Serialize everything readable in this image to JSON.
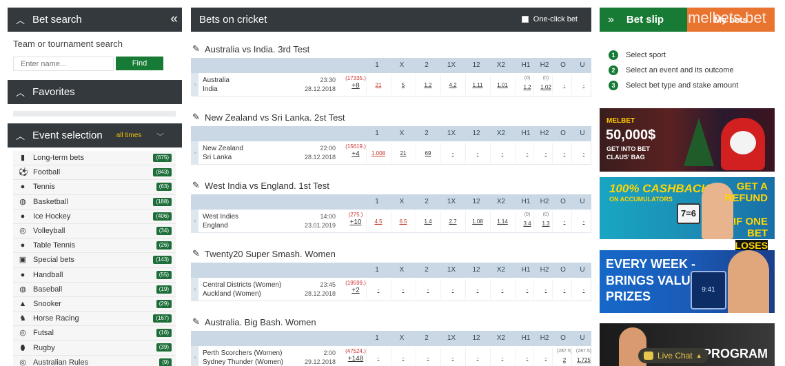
{
  "bet_search": {
    "title": "Bet search",
    "label": "Team or tournament search",
    "placeholder": "Enter name...",
    "find_label": "Find"
  },
  "favorites": {
    "title": "Favorites"
  },
  "event_selection": {
    "title": "Event selection",
    "filter": "all times",
    "sports": [
      {
        "name": "Long-term bets",
        "count": "(675)",
        "icon": "chart-bars-icon"
      },
      {
        "name": "Football",
        "count": "(843)",
        "icon": "football-icon"
      },
      {
        "name": "Tennis",
        "count": "(63)",
        "icon": "tennis-icon"
      },
      {
        "name": "Basketball",
        "count": "(188)",
        "icon": "basketball-icon"
      },
      {
        "name": "Ice Hockey",
        "count": "(406)",
        "icon": "ice-hockey-icon"
      },
      {
        "name": "Volleyball",
        "count": "(34)",
        "icon": "volleyball-icon"
      },
      {
        "name": "Table Tennis",
        "count": "(26)",
        "icon": "table-tennis-icon"
      },
      {
        "name": "Special bets",
        "count": "(143)",
        "icon": "special-bets-icon"
      },
      {
        "name": "Handball",
        "count": "(55)",
        "icon": "handball-icon"
      },
      {
        "name": "Baseball",
        "count": "(19)",
        "icon": "baseball-icon"
      },
      {
        "name": "Snooker",
        "count": "(29)",
        "icon": "snooker-icon"
      },
      {
        "name": "Horse Racing",
        "count": "(167)",
        "icon": "horse-racing-icon"
      },
      {
        "name": "Futsal",
        "count": "(16)",
        "icon": "futsal-icon"
      },
      {
        "name": "Rugby",
        "count": "(39)",
        "icon": "rugby-icon"
      },
      {
        "name": "Australian Rules",
        "count": "(9)",
        "icon": "australian-rules-icon"
      }
    ]
  },
  "main": {
    "title": "Bets on cricket",
    "one_click": "One-click bet",
    "columns": [
      "1",
      "X",
      "2",
      "1X",
      "12",
      "X2",
      "H1",
      "H2",
      "O",
      "U"
    ],
    "events": [
      {
        "name": "Australia vs India. 3rd Test",
        "team1": "Australia",
        "team2": "India",
        "time": "23:30",
        "date": "28.12.2018",
        "count": "(17335.)",
        "more": "+8",
        "odds": [
          "21",
          "5",
          "1.2",
          "4.2",
          "1.11",
          "1.01",
          "1.2",
          "1.02",
          "-",
          "-"
        ],
        "params": [
          "",
          "",
          "",
          "",
          "",
          "",
          "(0)",
          "(0)",
          "",
          ""
        ]
      },
      {
        "name": "New Zealand vs Sri Lanka. 2st Test",
        "team1": "New Zealand",
        "team2": "Sri Lanka",
        "time": "22:00",
        "date": "28.12.2018",
        "count": "(15619.)",
        "more": "+4",
        "odds": [
          "1.008",
          "21",
          "69",
          "-",
          "-",
          "-",
          "-",
          "-",
          "-",
          "-"
        ],
        "params": [
          "",
          "",
          "",
          "",
          "",
          "",
          "",
          "",
          "",
          ""
        ]
      },
      {
        "name": "West India vs England. 1st Test",
        "team1": "West Indies",
        "team2": "England",
        "time": "14:00",
        "date": "23.01.2019",
        "count": "(275.)",
        "more": "+10",
        "odds": [
          "4.5",
          "6.5",
          "1.4",
          "2.7",
          "1.08",
          "1.14",
          "3.4",
          "1.3",
          "-",
          "-"
        ],
        "params": [
          "",
          "",
          "",
          "",
          "",
          "",
          "(0)",
          "(0)",
          "",
          ""
        ]
      },
      {
        "name": "Twenty20 Super Smash. Women",
        "team1": "Central Districts (Women)",
        "team2": "Auckland (Women)",
        "time": "23:45",
        "date": "28.12.2018",
        "count": "(19599.)",
        "more": "+2",
        "odds": [
          "-",
          "-",
          "-",
          "-",
          "-",
          "-",
          "-",
          "-",
          "-",
          "-"
        ],
        "params": [
          "",
          "",
          "",
          "",
          "",
          "",
          "",
          "",
          "",
          ""
        ]
      },
      {
        "name": "Australia. Big Bash. Women",
        "team1": "Perth Scorchers (Women)",
        "team2": "Sydney Thunder (Women)",
        "time": "2:00",
        "date": "29.12.2018",
        "count": "(47524.)",
        "more": "+148",
        "odds": [
          "-",
          "-",
          "-",
          "-",
          "-",
          "-",
          "-",
          "-",
          "2",
          "1.725"
        ],
        "params": [
          "",
          "",
          "",
          "",
          "",
          "",
          "",
          "",
          "(287.5)",
          "(287.5)"
        ]
      }
    ]
  },
  "bet_slip": {
    "title": "Bet slip",
    "my_bets": "My bets",
    "watermark": "melbets.bet",
    "steps": [
      "Select sport",
      "Select an event and its outcome",
      "Select bet type and stake amount"
    ]
  },
  "banners": {
    "b1": {
      "brand": "MELBET",
      "amount": "50,000$",
      "line1": "GET INTO BET",
      "line2": "CLAUS' BAG"
    },
    "b2": {
      "l1": "100% CASHBACK",
      "l2": "ON ACCUMULATORS",
      "score": "7=6",
      "r1": "GET A",
      "r2": "REFUND",
      "r3": "IF ONE",
      "r4": "BET",
      "r5": "LOSES"
    },
    "b3": {
      "l1": "EVERY WEEK -",
      "l2": "BRINGS VALUABLE",
      "l3": "PRIZES",
      "screen": "9:41"
    },
    "b4": {
      "l1": "PROGRAM"
    }
  },
  "live_chat": "Live Chat",
  "colors": {
    "dark": "#33393d",
    "green": "#177a35",
    "orange": "#e8742f",
    "odds_header": "#c9d8e4"
  }
}
